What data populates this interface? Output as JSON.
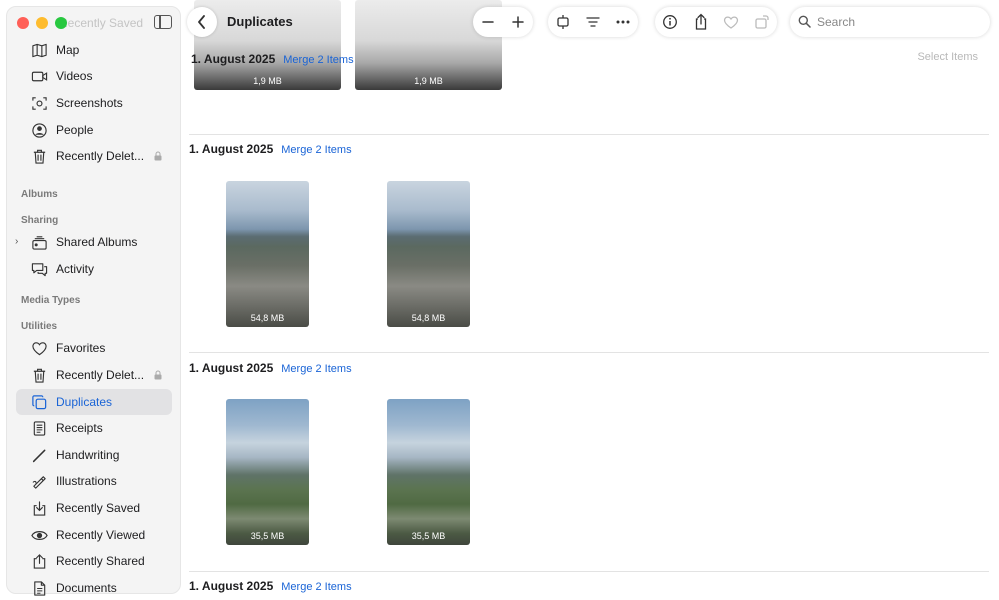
{
  "window": {
    "title": "Duplicates"
  },
  "sidebar": {
    "faded_item": "Recently Saved",
    "items_top": [
      {
        "label": "Map",
        "icon": "map-icon"
      },
      {
        "label": "Videos",
        "icon": "video-icon"
      },
      {
        "label": "Screenshots",
        "icon": "screenshot-icon"
      },
      {
        "label": "People",
        "icon": "person-icon"
      },
      {
        "label": "Recently Delet...",
        "icon": "trash-icon",
        "locked": true
      }
    ],
    "section_albums": "Albums",
    "section_sharing": "Sharing",
    "sharing_items": [
      {
        "label": "Shared Albums",
        "icon": "shared-albums-icon"
      },
      {
        "label": "Activity",
        "icon": "activity-icon"
      }
    ],
    "section_media_types": "Media Types",
    "section_utilities": "Utilities",
    "utility_items": [
      {
        "label": "Favorites",
        "icon": "heart-icon"
      },
      {
        "label": "Recently Delet...",
        "icon": "trash-icon",
        "locked": true
      },
      {
        "label": "Duplicates",
        "icon": "duplicates-icon",
        "selected": true
      },
      {
        "label": "Receipts",
        "icon": "receipt-icon"
      },
      {
        "label": "Handwriting",
        "icon": "pen-icon"
      },
      {
        "label": "Illustrations",
        "icon": "illustration-icon"
      },
      {
        "label": "Recently Saved",
        "icon": "saved-icon"
      },
      {
        "label": "Recently Viewed",
        "icon": "eye-icon"
      },
      {
        "label": "Recently Shared",
        "icon": "share-icon"
      },
      {
        "label": "Documents",
        "icon": "document-icon"
      }
    ]
  },
  "toolbar": {
    "title": "Duplicates",
    "search_placeholder": "Search"
  },
  "content": {
    "select_items": "Select Items",
    "groups": [
      {
        "date": "1. August 2025",
        "merge": "Merge 2 Items",
        "sizes": [
          "1,9 MB",
          "1,9 MB"
        ]
      },
      {
        "date": "1. August 2025",
        "merge": "Merge 2 Items",
        "sizes": [
          "54,8 MB",
          "54,8 MB"
        ]
      },
      {
        "date": "1. August 2025",
        "merge": "Merge 2 Items",
        "sizes": [
          "35,5 MB",
          "35,5 MB"
        ]
      },
      {
        "date": "1. August 2025",
        "merge": "Merge 2 Items",
        "sizes": []
      }
    ]
  },
  "colors": {
    "accent": "#1a64d6",
    "selected_bg": "#e2e2e4"
  }
}
